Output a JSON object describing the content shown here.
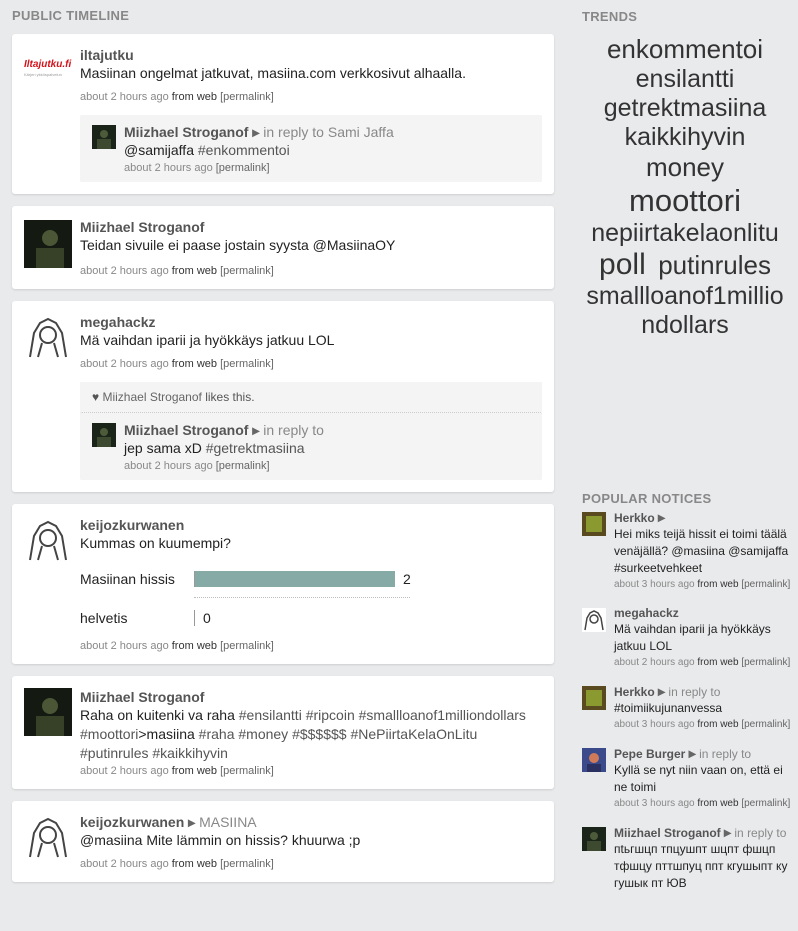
{
  "headings": {
    "timeline": "PUBLIC TIMELINE",
    "trends": "TRENDS",
    "popular": "POPULAR NOTICES"
  },
  "colors": {
    "background": "#e9eaec",
    "card": "#ffffff",
    "poll_bar": "#86aaa5"
  },
  "timeline": [
    {
      "avatar": "iltajutku-logo",
      "nick": "iltajutku",
      "content": "Masiinan ongelmat jatkuvat, masiina.com verkkosivut alhaalla.",
      "time": "about 2 hours ago",
      "from": "from",
      "source": "web",
      "permalink": "[permalink]",
      "reply": {
        "nick": "Miizhael Stroganof",
        "reply_text": "in reply to Sami Jaffa",
        "content_a": "@samijaffa",
        "content_b": "#enkommentoi",
        "time": "about 2 hours ago",
        "permalink": "[permalink]"
      }
    },
    {
      "nick": "Miizhael Stroganof",
      "content": "Teidan sivuile ei paase jostain syysta @MasiinaOY",
      "time": "about 2 hours ago",
      "from": "from",
      "source": "web",
      "permalink": "[permalink]"
    },
    {
      "nick": "megahackz",
      "content": "Mä vaihdan iparii ja hyökkäys jatkuu LOL",
      "time": "about 2 hours ago",
      "from": "from",
      "source": "web",
      "permalink": "[permalink]",
      "likes": {
        "user": "Miizhael Stroganof",
        "text": "likes this."
      },
      "reply": {
        "nick": "Miizhael Stroganof",
        "reply_text": "in reply to",
        "content_a": "jep sama xD",
        "content_b": "#getrektmasiina",
        "time": "about 2 hours ago",
        "permalink": "[permalink]"
      }
    },
    {
      "nick": "keijozkurwanen",
      "content": "Kummas on kuumempi?",
      "poll": [
        {
          "label": "Masiinan hissis",
          "votes": 2,
          "fraction": 1.0
        },
        {
          "label": "helvetis",
          "votes": 0,
          "fraction": 0.0
        }
      ],
      "time": "about 2 hours ago",
      "from": "from",
      "source": "web",
      "permalink": "[permalink]"
    },
    {
      "nick": "Miizhael Stroganof",
      "content_parts": [
        "Raha on kuitenki va raha ",
        "#ensilantti",
        " ",
        "#ripcoin",
        " ",
        "#smallloanof1milliondollars",
        " ",
        "#moottori",
        ">masiina ",
        "#raha",
        " ",
        "#money",
        " ",
        "#$$$$$$",
        " ",
        "#NePiirtaKelaOnLitu",
        " ",
        "#putinrules",
        " ",
        "#kaikkihyvin"
      ],
      "time": "about 2 hours ago",
      "from": "from",
      "source": "web",
      "permalink": "[permalink]"
    },
    {
      "nick": "keijozkurwanen",
      "group": "MASIINA",
      "content_a": "@masiina",
      "content_b": "Mite lämmin on hissis? khuurwa ;p",
      "time": "about 2 hours ago",
      "from": "from",
      "source": "web",
      "permalink": "[permalink]"
    }
  ],
  "trends": [
    {
      "tag": "enkommentoi",
      "weight": 26
    },
    {
      "tag": "ensilantti",
      "weight": 25
    },
    {
      "tag": "getrektmasiina",
      "weight": 25
    },
    {
      "tag": "kaikkihyvin",
      "weight": 25
    },
    {
      "tag": "money",
      "weight": 26
    },
    {
      "tag": "moottori",
      "weight": 31
    },
    {
      "tag": "nepiirtakelaonlitu",
      "weight": 25
    },
    {
      "tag": "poll",
      "weight": 30
    },
    {
      "tag": "putinrules",
      "weight": 26
    },
    {
      "tag": "smallloanof1milliondollars",
      "weight": 25
    }
  ],
  "popular": [
    {
      "nick": "Herkko",
      "content": "Hei miks teijä hissit ei toimi täälä venäjällä? @masiina @samijaffa #surkeetvehkeet",
      "time": "about 3 hours ago",
      "from": "from",
      "source": "web",
      "permalink": "[permalink]"
    },
    {
      "nick": "megahackz",
      "content": "Mä vaihdan iparii ja hyökkäys jatkuu LOL",
      "time": "about 2 hours ago",
      "from": "from",
      "source": "web",
      "permalink": "[permalink]"
    },
    {
      "nick": "Herkko",
      "reply_text": "in reply to",
      "content": "#toimiikujunanvessa",
      "time": "about 3 hours ago",
      "from": "from",
      "source": "web",
      "permalink": "[permalink]"
    },
    {
      "nick": "Pepe Burger",
      "reply_text": "in reply to",
      "content": "Kyllä se nyt niin vaan on, että ei ne toimi",
      "time": "about 3 hours ago",
      "from": "from",
      "source": "web",
      "permalink": "[permalink]"
    },
    {
      "nick": "Miizhael Stroganof",
      "reply_text": "in reply to",
      "content": "пtьгшцп тпцушпт шцпт фшцп тфшцу пттшпуц ппт кгушыпт ку гушык пт ЮВ"
    }
  ]
}
